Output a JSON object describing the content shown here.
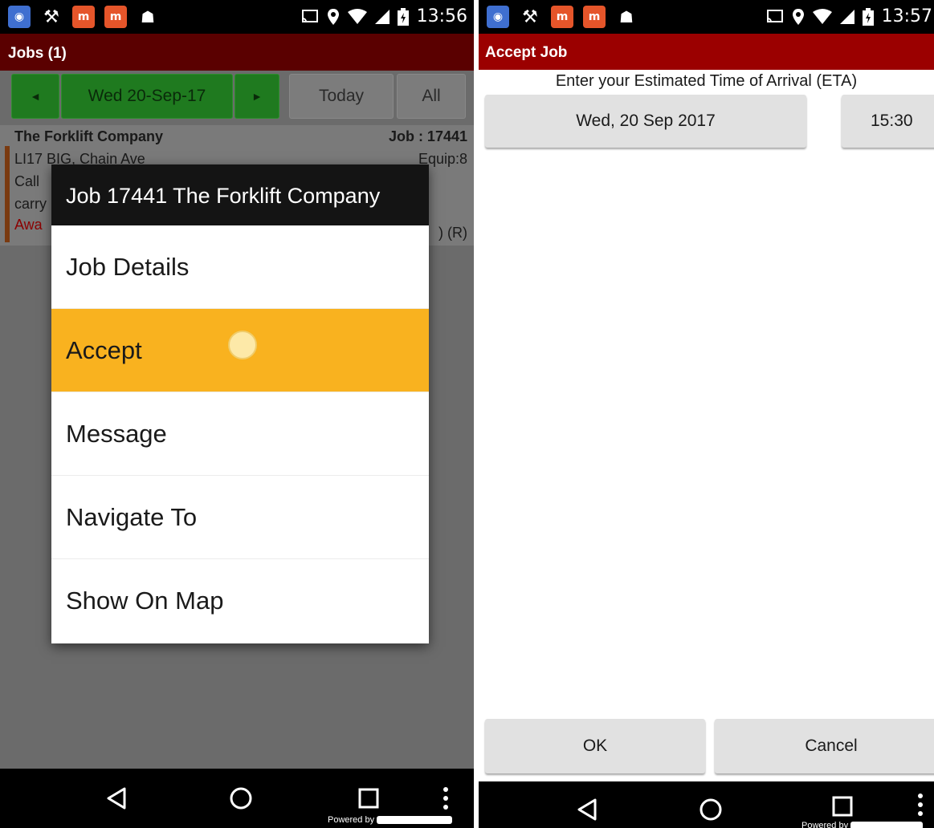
{
  "left": {
    "status": {
      "time": "13:56"
    },
    "appbar_title": "Jobs (1)",
    "toolbar": {
      "prev": "◄",
      "date": "Wed 20-Sep-17",
      "next": "►",
      "today": "Today",
      "all": "All"
    },
    "job": {
      "company": "The Forklift Company",
      "job_number": "Job : 17441",
      "address": "LI17 BIG, Chain Ave",
      "equip": "Equip:8",
      "line2": "Call",
      "line3": "carry",
      "status": "Awa",
      "status_right": ") (R)"
    },
    "dialog": {
      "title": "Job 17441 The Forklift Company",
      "items": [
        "Job Details",
        "Accept",
        "Message",
        "Navigate To",
        "Show On Map"
      ]
    },
    "powered_by": "Powered by"
  },
  "right": {
    "status": {
      "time": "13:57"
    },
    "appbar_title": "Accept Job",
    "eta_label": "Enter your Estimated Time of Arrival (ETA)",
    "date_button": "Wed, 20 Sep 2017",
    "time_button": "15:30",
    "ok_button": "OK",
    "cancel_button": "Cancel",
    "powered_by": "Powered by"
  }
}
